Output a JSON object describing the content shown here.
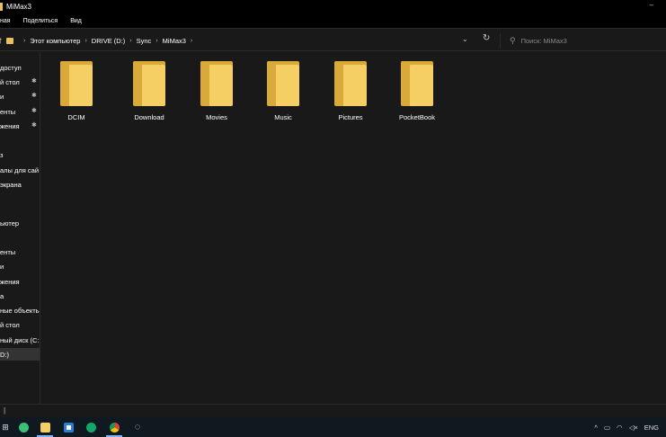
{
  "window": {
    "title": "MiMax3"
  },
  "ribbon": {
    "tabs": [
      "ная",
      "Поделиться",
      "Вид"
    ]
  },
  "address": {
    "crumbs": [
      "Этот компьютер",
      "DRIVE (D:)",
      "Sync",
      "MiMax3"
    ],
    "search_placeholder": "Поиск: MiMax3"
  },
  "sidebar": {
    "items": [
      {
        "label": "доступ",
        "pinned": false
      },
      {
        "label": "й стол",
        "pinned": true
      },
      {
        "label": "и",
        "pinned": true
      },
      {
        "label": "енты",
        "pinned": true
      },
      {
        "label": "жения",
        "pinned": true
      },
      {
        "label": "з",
        "pinned": false
      },
      {
        "label": "алы для сай",
        "pinned": false
      },
      {
        "label": "экрана",
        "pinned": false
      },
      {
        "label": "ьютер",
        "pinned": false
      },
      {
        "label": "енты",
        "pinned": false
      },
      {
        "label": "и",
        "pinned": false
      },
      {
        "label": "жения",
        "pinned": false
      },
      {
        "label": "а",
        "pinned": false
      },
      {
        "label": "ные объекть",
        "pinned": false
      },
      {
        "label": "й стол",
        "pinned": false
      },
      {
        "label": "ный диск (С:",
        "pinned": false
      },
      {
        "label": "D:)",
        "pinned": false
      }
    ]
  },
  "folders": [
    "DCIM",
    "Download",
    "Movies",
    "Music",
    "Pictures",
    "PocketBook"
  ],
  "status": {
    "mark": "|"
  },
  "tray": {
    "language": "ENG"
  },
  "colors": {
    "folder_front": "#f5cf63",
    "folder_back": "#d9a93a",
    "background": "#191919"
  }
}
